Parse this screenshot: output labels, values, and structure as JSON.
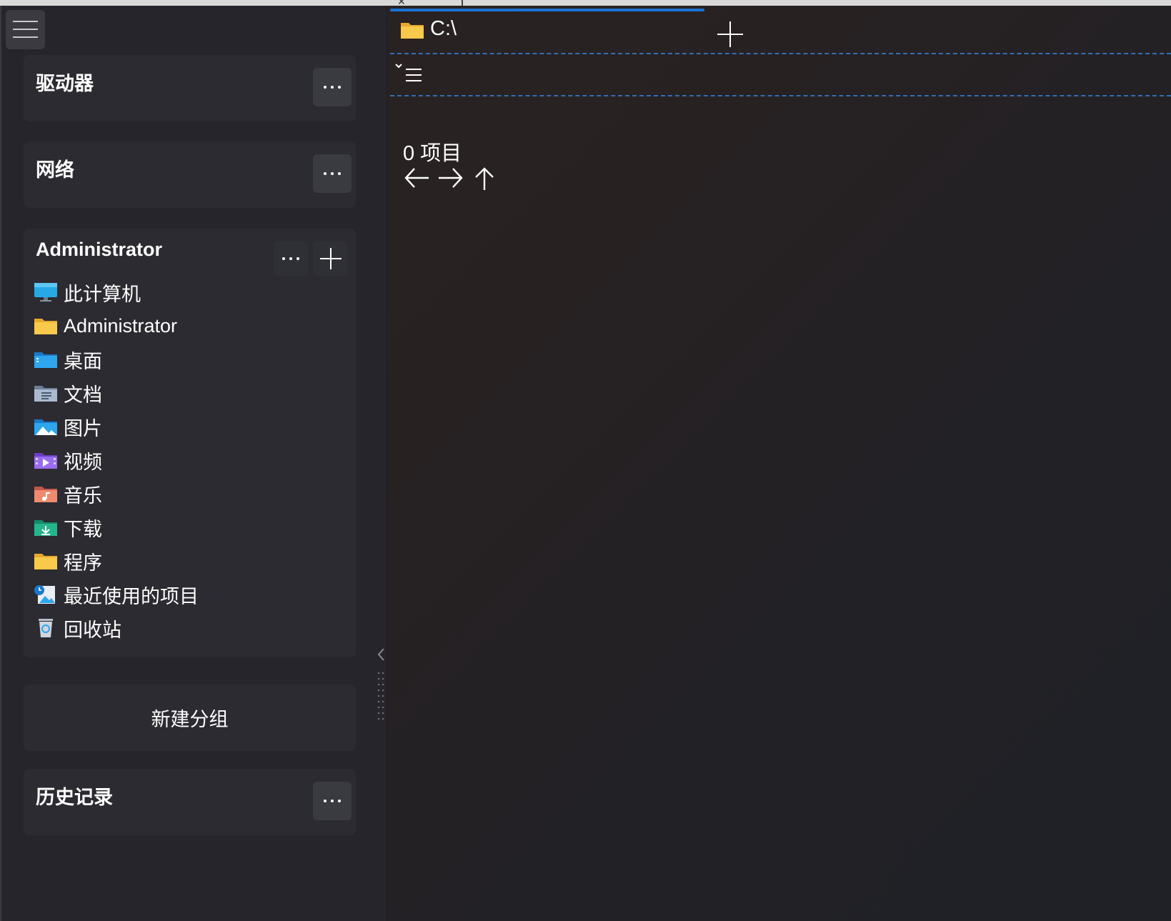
{
  "sidebar": {
    "sections": {
      "drives": {
        "title": "驱动器"
      },
      "network": {
        "title": "网络"
      },
      "admin": {
        "title": "Administrator",
        "items": [
          {
            "label": "此计算机",
            "icon": "computer-icon"
          },
          {
            "label": "Administrator",
            "icon": "folder-icon"
          },
          {
            "label": "桌面",
            "icon": "desktop-folder-icon"
          },
          {
            "label": "文档",
            "icon": "documents-folder-icon"
          },
          {
            "label": "图片",
            "icon": "pictures-folder-icon"
          },
          {
            "label": "视频",
            "icon": "videos-folder-icon"
          },
          {
            "label": "音乐",
            "icon": "music-folder-icon"
          },
          {
            "label": "下载",
            "icon": "downloads-folder-icon"
          },
          {
            "label": "程序",
            "icon": "folder-icon"
          },
          {
            "label": "最近使用的项目",
            "icon": "recent-items-icon"
          },
          {
            "label": "回收站",
            "icon": "recycle-bin-icon"
          }
        ]
      },
      "history": {
        "title": "历史记录"
      }
    },
    "new_group_label": "新建分组"
  },
  "tabs": [
    {
      "label": "C:\\",
      "icon": "folder-icon",
      "active": true
    }
  ],
  "main": {
    "item_count": "0 项目"
  },
  "colors": {
    "accent": "#1a73d6",
    "sidebar_bg": "#25252b",
    "section_bg": "#2b2b31",
    "folder_yellow": "#f8c94a"
  }
}
